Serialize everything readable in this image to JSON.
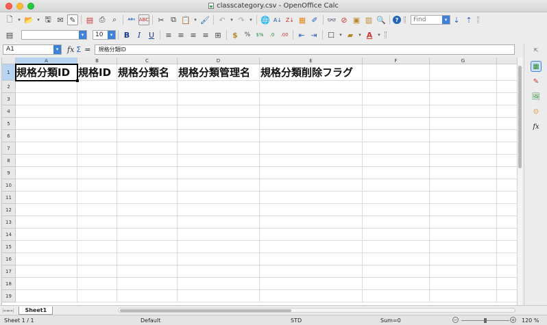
{
  "window": {
    "title": "classcategory.csv - OpenOffice Calc"
  },
  "toolbar1": {
    "find_placeholder": "Find",
    "icons": [
      "new-icon",
      "open-icon",
      "save-icon",
      "email-icon",
      "edit-file-icon",
      "export-pdf-icon",
      "print-icon",
      "print-preview-icon",
      "spellcheck-icon",
      "autospellcheck-icon",
      "cut-icon",
      "copy-icon",
      "paste-icon",
      "clone-format-icon",
      "undo-icon",
      "redo-icon",
      "hyperlink-icon",
      "sort-ascending-icon",
      "sort-descending-icon",
      "chart-icon",
      "draw-functions-icon",
      "find-replace-icon",
      "navigator-icon",
      "gallery-icon",
      "zoom-icon",
      "help-icon"
    ]
  },
  "toolbar2": {
    "font_name": "",
    "font_size": "10",
    "bold": "B",
    "italic": "I",
    "underline": "U"
  },
  "formula_bar": {
    "name_box": "A1",
    "content": "規格分類ID"
  },
  "sheet": {
    "columns": [
      "A",
      "B",
      "C",
      "D",
      "E",
      "F",
      "G"
    ],
    "rows": [
      "1",
      "2",
      "3",
      "4",
      "5",
      "6",
      "7",
      "8",
      "9",
      "10",
      "11",
      "12",
      "13",
      "14",
      "15",
      "16",
      "17",
      "18",
      "19"
    ],
    "row1": [
      "規格分類ID",
      "規格ID",
      "規格分類名",
      "規格分類管理名",
      "規格分類削除フラグ",
      "",
      ""
    ],
    "active_cell": "A1"
  },
  "tabs": {
    "sheet_tab": "Sheet1"
  },
  "status": {
    "sheet": "Sheet 1 / 1",
    "page_style": "Default",
    "mode": "STD",
    "sum": "Sum=0",
    "zoom": "120 %"
  }
}
